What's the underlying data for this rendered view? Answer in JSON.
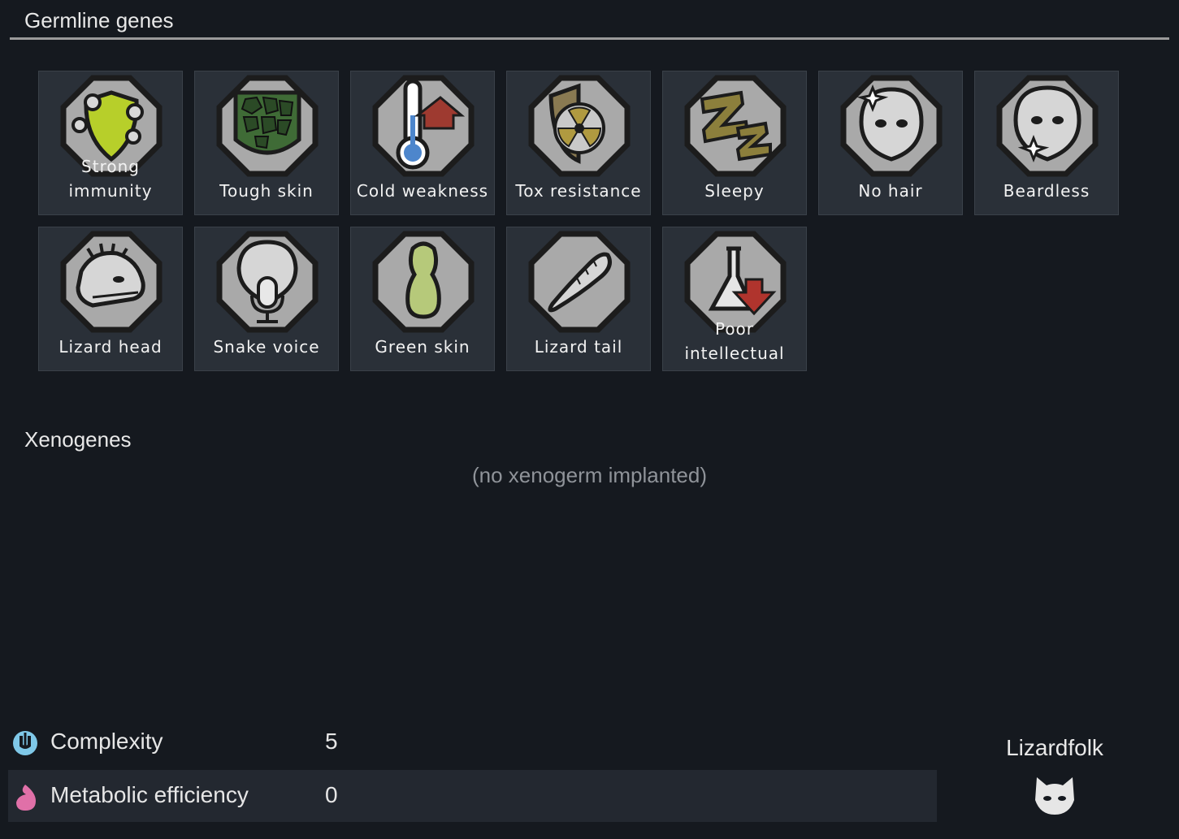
{
  "germline": {
    "title": "Germline genes",
    "genes": [
      {
        "label": "Strong immunity",
        "icon": "strong-immunity-icon"
      },
      {
        "label": "Tough skin",
        "icon": "tough-skin-icon"
      },
      {
        "label": "Cold weakness",
        "icon": "cold-weakness-icon"
      },
      {
        "label": "Tox resistance",
        "icon": "tox-resistance-icon"
      },
      {
        "label": "Sleepy",
        "icon": "sleepy-icon"
      },
      {
        "label": "No hair",
        "icon": "no-hair-icon"
      },
      {
        "label": "Beardless",
        "icon": "beardless-icon"
      },
      {
        "label": "Lizard head",
        "icon": "lizard-head-icon"
      },
      {
        "label": "Snake voice",
        "icon": "snake-voice-icon"
      },
      {
        "label": "Green skin",
        "icon": "green-skin-icon"
      },
      {
        "label": "Lizard tail",
        "icon": "lizard-tail-icon"
      },
      {
        "label_line1": "Poor",
        "label_line2": "intellectual",
        "icon": "poor-intellectual-icon"
      }
    ]
  },
  "xenogenes": {
    "title": "Xenogenes",
    "empty_text": "(no xenogerm implanted)"
  },
  "stats": {
    "complexity": {
      "label": "Complexity",
      "value": "5",
      "icon": "complexity-icon",
      "color": "#7fc8e8"
    },
    "metabolic": {
      "label": "Metabolic efficiency",
      "value": "0",
      "icon": "metabolism-icon",
      "color": "#e070a8"
    }
  },
  "xenotype": {
    "name": "Lizardfolk",
    "icon": "lizardfolk-xenotype-icon"
  },
  "colors": {
    "background": "#15191f",
    "tile": "#2a3038",
    "text": "#e6e6e6",
    "muted": "#8f9399"
  }
}
